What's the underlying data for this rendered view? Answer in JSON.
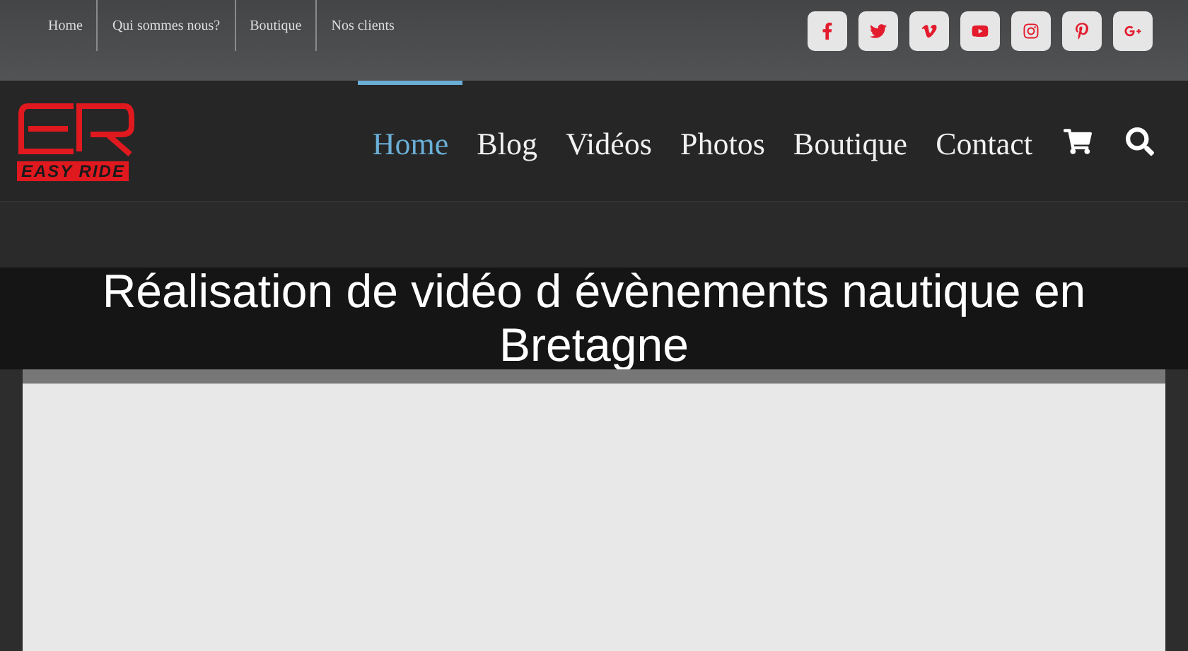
{
  "top_menu": [
    {
      "label": "Home"
    },
    {
      "label": "Qui sommes nous?"
    },
    {
      "label": "Boutique"
    },
    {
      "label": "Nos clients"
    }
  ],
  "social_links": [
    {
      "kind": "facebook"
    },
    {
      "kind": "twitter"
    },
    {
      "kind": "vimeo"
    },
    {
      "kind": "youtube"
    },
    {
      "kind": "instagram"
    },
    {
      "kind": "pinterest"
    },
    {
      "kind": "googleplus"
    }
  ],
  "logo": {
    "text": "EASY RIDE"
  },
  "main_nav": [
    {
      "label": "Home",
      "selected": true
    },
    {
      "label": "Blog",
      "selected": false
    },
    {
      "label": "Vidéos",
      "selected": false
    },
    {
      "label": "Photos",
      "selected": false
    },
    {
      "label": "Boutique",
      "selected": false
    },
    {
      "label": "Contact",
      "selected": false
    }
  ],
  "caption": "Réalisation de vidéo d évènements nautique en Bretagne"
}
